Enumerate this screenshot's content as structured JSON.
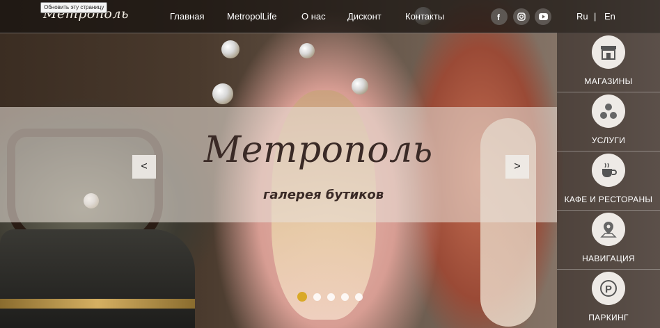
{
  "topbar": {
    "logo_text": "Метрополь",
    "tooltip": "Обновить эту страницу",
    "nav": [
      "Главная",
      "MetropolLife",
      "О нас",
      "Дисконт",
      "Контакты"
    ],
    "social_icons": [
      "facebook-icon",
      "instagram-icon",
      "youtube-icon"
    ],
    "lang_ru": "Ru",
    "lang_sep": "|",
    "lang_en": "En"
  },
  "slider": {
    "brand_title": "Метрополь",
    "brand_subtitle": "галерея бутиков",
    "prev_label": "<",
    "next_label": ">",
    "dots_count": 5,
    "active_dot": 1,
    "accent_color": "#d9a928"
  },
  "sidebar": {
    "items": [
      {
        "label": "МАГАЗИНЫ",
        "icon": "shop-icon"
      },
      {
        "label": "УСЛУГИ",
        "icon": "services-icon"
      },
      {
        "label": "КАФЕ И РЕСТОРАНЫ",
        "icon": "coffee-icon"
      },
      {
        "label": "НАВИГАЦИЯ",
        "icon": "map-pin-icon"
      },
      {
        "label": "ПАРКИНГ",
        "icon": "parking-icon"
      }
    ]
  }
}
